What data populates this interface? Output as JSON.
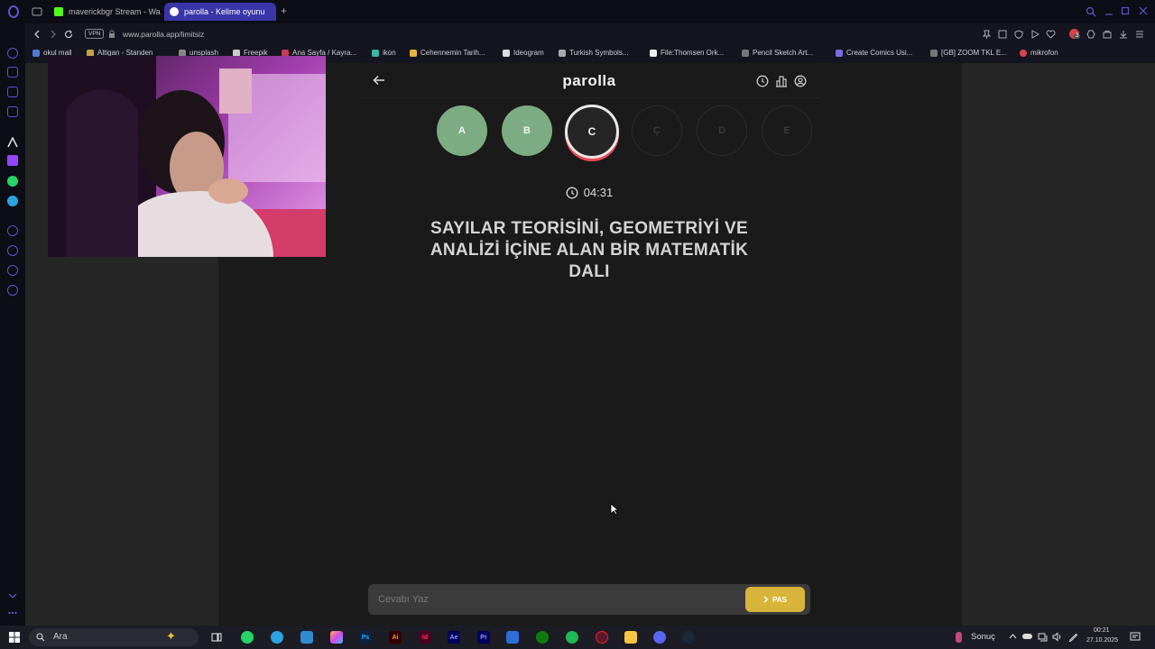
{
  "browser": {
    "tabs": [
      {
        "label": "maverickbgr Stream - Wa",
        "favicon_color": "#53fc18"
      },
      {
        "label": "parolla - Kelime oyunu",
        "favicon_color": "#ffffff"
      }
    ],
    "new_tab": "+",
    "vpn_badge": "VPN",
    "url": "www.parolla.app/limitsiz",
    "extension_badge": "3",
    "bookmarks": [
      "okul mail",
      "Altigan - Standen",
      "unsplash",
      "Freepik",
      "Ana Sayfa / Kayra...",
      "ikon",
      "Cehennemin Tarih...",
      "Ideogram",
      "Turkish Symbols...",
      "File:Thomsen Ork...",
      "Pencil Sketch Art...",
      "Create Comics Usi...",
      "[GB] ZOOM TKL E...",
      "mikrofon"
    ]
  },
  "game": {
    "title": "parolla",
    "letters": [
      {
        "char": "A",
        "state": "correct"
      },
      {
        "char": "B",
        "state": "correct"
      },
      {
        "char": "C",
        "state": "active"
      },
      {
        "char": "Ç",
        "state": "pending"
      },
      {
        "char": "D",
        "state": "pending"
      },
      {
        "char": "E",
        "state": "pending"
      }
    ],
    "timer": "04:31",
    "question": "SAYILAR TEORİSİNİ, GEOMETRİYİ VE ANALİZİ İÇİNE ALAN BİR MATEMATİK DALI",
    "answer_placeholder": "Cevabı Yaz",
    "pass_label": "PAS"
  },
  "taskbar": {
    "search_placeholder": "Ara",
    "weather": "Sonuç",
    "clock_time": "00:21",
    "clock_date": "27.10.2025"
  },
  "colors": {
    "correct": "#7dac83",
    "active_border": "#e8e8e8",
    "active_ring": "#e84855",
    "pass_button": "#d8b53a",
    "accent": "#5a55c9"
  }
}
